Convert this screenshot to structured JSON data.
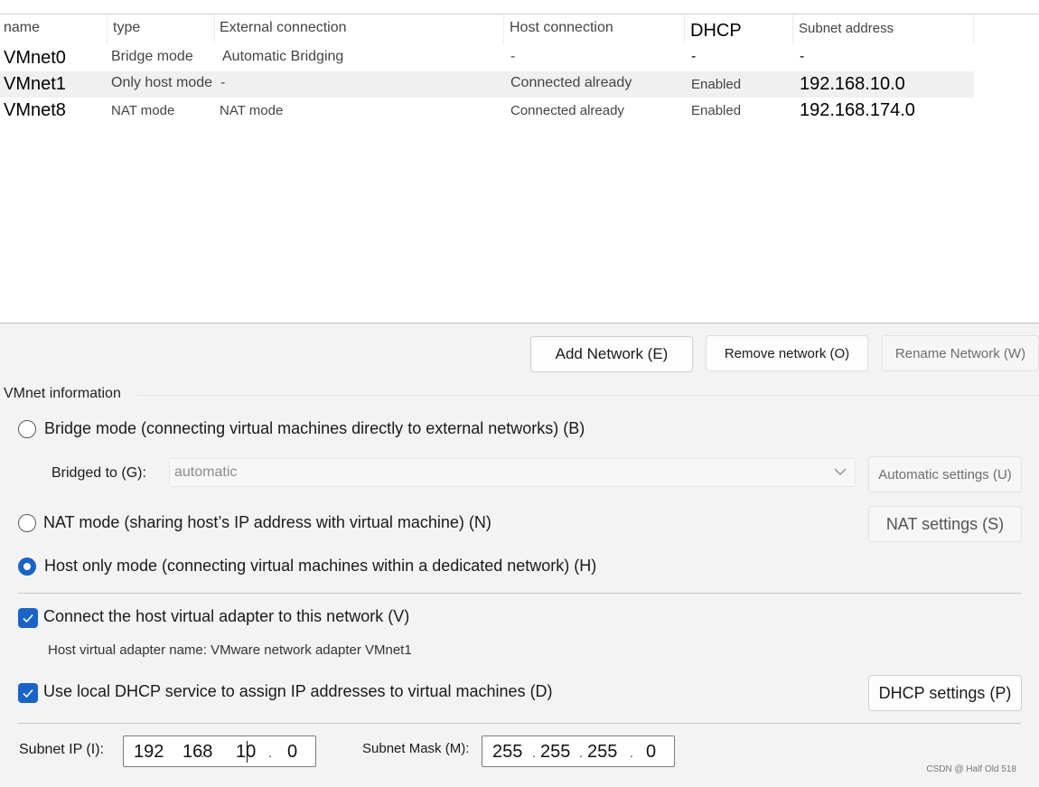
{
  "table": {
    "headers": [
      "name",
      "type",
      "External connection",
      "Host connection",
      "DHCP",
      "Subnet address"
    ],
    "rows": [
      {
        "name": "VMnet0",
        "type": "Bridge mode",
        "external": "Automatic Bridging",
        "host": "-",
        "dhcp": "-",
        "subnet": "-"
      },
      {
        "name": "VMnet1",
        "type": "Only host mode",
        "external": "-",
        "host": "Connected already",
        "dhcp": "Enabled",
        "subnet": "192.168.10.0"
      },
      {
        "name": "VMnet8",
        "type": "NAT mode",
        "external": "NAT mode",
        "host": "Connected already",
        "dhcp": "Enabled",
        "subnet": "192.168.174.0"
      }
    ],
    "selected_row": 1
  },
  "buttons": {
    "add": "Add Network (E)",
    "remove": "Remove network (O)",
    "rename": "Rename Network (W)"
  },
  "info": {
    "title": "VMnet information",
    "bridge_label": "Bridge mode (connecting virtual machines directly to external networks) (B)",
    "bridged_to_label": "Bridged to (G):",
    "bridged_to_value": "automatic",
    "auto_settings": "Automatic settings (U)",
    "nat_label": "NAT mode (sharing host’s IP address with virtual machine) (N)",
    "nat_settings": "NAT settings (S)",
    "host_only_label": "Host only mode (connecting virtual machines within a dedicated network) (H)",
    "selected_mode": "host_only",
    "connect_label": "Connect the host virtual adapter to this network (V)",
    "connect_checked": true,
    "adapter_name": "Host virtual adapter name: VMware network adapter VMnet1",
    "dhcp_label": "Use local DHCP service to assign IP addresses to virtual machines (D)",
    "dhcp_checked": true,
    "dhcp_settings": "DHCP settings (P)",
    "subnet_ip_label": "Subnet IP (I):",
    "subnet_ip": [
      "192",
      "168",
      "10",
      "0"
    ],
    "subnet_mask_label": "Subnet Mask (M):",
    "subnet_mask": [
      "255",
      "255",
      "255",
      "0"
    ]
  },
  "watermark": "CSDN @ Half Old 518",
  "colors": {
    "accent": "#1a63c6",
    "selected_row": "#f0f0f0"
  }
}
